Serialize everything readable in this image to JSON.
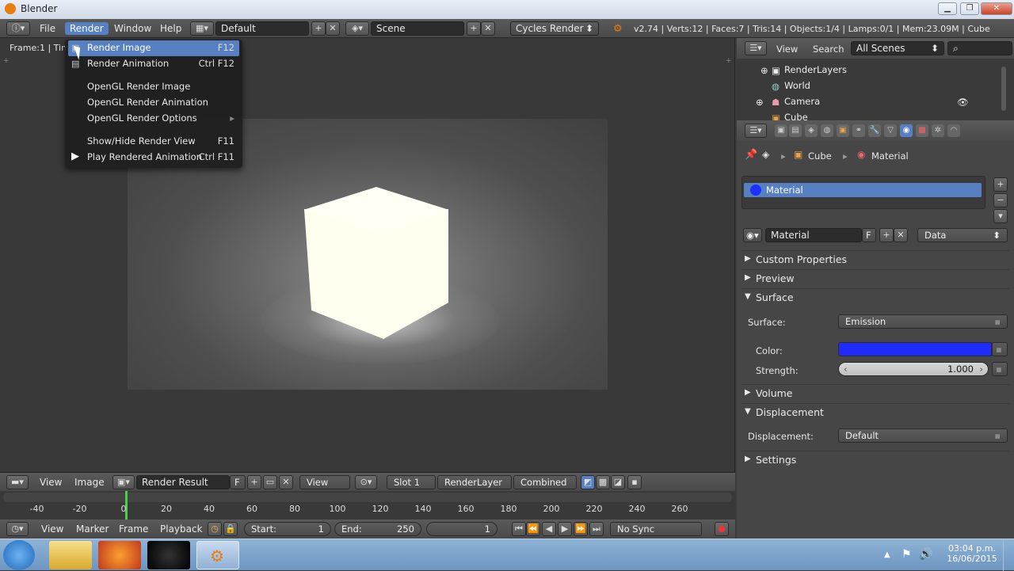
{
  "window": {
    "title": "Blender"
  },
  "info_header": {
    "menus": [
      "File",
      "Render",
      "Window",
      "Help"
    ],
    "layout": "Default",
    "scene": "Scene",
    "engine": "Cycles Render",
    "stats": "v2.74 | Verts:12 | Faces:7 | Tris:14 | Objects:1/4 | Lamps:0/1 | Mem:23.09M | Cube"
  },
  "viewport": {
    "frame_label": "Frame:1 | Tim"
  },
  "render_menu": {
    "items": [
      {
        "label": "Render Image",
        "shortcut": "F12",
        "selected": true
      },
      {
        "label": "Render Animation",
        "shortcut": "Ctrl F12"
      },
      {
        "label": "OpenGL Render Image",
        "shortcut": ""
      },
      {
        "label": "OpenGL Render Animation",
        "shortcut": ""
      },
      {
        "label": "OpenGL Render Options",
        "shortcut": "▸"
      },
      {
        "label": "Show/Hide Render View",
        "shortcut": "F11"
      },
      {
        "label": "Play Rendered Animation",
        "shortcut": "Ctrl F11"
      }
    ]
  },
  "outliner": {
    "view": "View",
    "search": "Search",
    "filter": "All Scenes",
    "items": [
      "RenderLayers",
      "World",
      "Camera",
      "Cube"
    ]
  },
  "properties": {
    "breadcrumb": [
      "Cube",
      "Material"
    ],
    "slot": "Material",
    "material_name": "Material",
    "fake_user": "F",
    "link": "Data",
    "panels": {
      "custom_props": "Custom Properties",
      "preview": "Preview",
      "surface": "Surface",
      "volume": "Volume",
      "displacement": "Displacement",
      "settings": "Settings"
    },
    "surface_label": "Surface:",
    "surface_value": "Emission",
    "color_label": "Color:",
    "color_value": "#1f2cff",
    "strength_label": "Strength:",
    "strength_value": "1.000",
    "displacement_label": "Displacement:",
    "displacement_value": "Default"
  },
  "image_header": {
    "view": "View",
    "image": "Image",
    "image_name": "Render Result",
    "fake": "F",
    "view2": "View",
    "slot": "Slot 1",
    "layer": "RenderLayer",
    "pass": "Combined"
  },
  "timeline": {
    "ticks": [
      "-40",
      "-20",
      "0",
      "20",
      "40",
      "60",
      "80",
      "100",
      "120",
      "140",
      "160",
      "180",
      "200",
      "220",
      "240",
      "260"
    ],
    "view": "View",
    "marker": "Marker",
    "frame": "Frame",
    "playback": "Playback",
    "start_label": "Start:",
    "start_value": "1",
    "end_label": "End:",
    "end_value": "250",
    "current": "1",
    "sync": "No Sync"
  },
  "taskbar": {
    "time": "03:04 p.m.",
    "date": "16/06/2015"
  }
}
